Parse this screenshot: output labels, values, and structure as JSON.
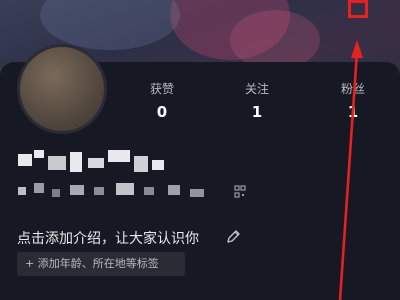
{
  "stats": [
    {
      "label": "获赞",
      "value": "0"
    },
    {
      "label": "关注",
      "value": "1"
    },
    {
      "label": "粉丝",
      "value": "1"
    }
  ],
  "bio_placeholder": "点击添加介绍，让大家认识你",
  "tag_placeholder": "+ 添加年龄、所在地等标签",
  "icons": {
    "edit": "pencil-icon",
    "menu": "menu-icon",
    "qr": "qr-code-icon"
  },
  "colors": {
    "background": "#161823",
    "annotation": "#e52222"
  }
}
